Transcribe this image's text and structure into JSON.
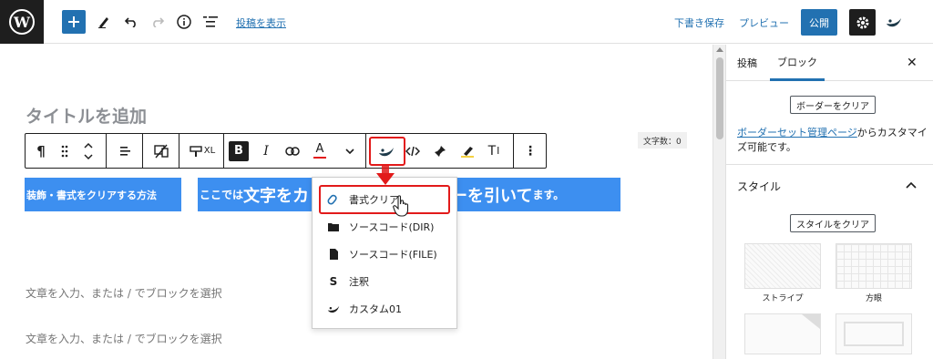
{
  "topbar": {
    "view_post": "投稿を表示",
    "save_draft": "下書き保存",
    "preview": "プレビュー",
    "publish": "公開"
  },
  "editor": {
    "title_placeholder": "タイトルを追加",
    "char_count": "文字数：0",
    "toolbar": {
      "paragraph": "¶",
      "text_xl": "XL",
      "bold": "B",
      "italic": "I",
      "text_color": "A",
      "clear_format": "T",
      "more": "⋮"
    },
    "highlight_1": "装飾・書式をクリアする方法",
    "highlight_2_pre": "ここでは",
    "highlight_2_big": "文字をカ",
    "highlight_2_mid": "ーカーを引いて",
    "highlight_2_suffix": "ます。",
    "placeholder_1": "文章を入力、または / でブロックを選択",
    "placeholder_2": "文章を入力、または / でブロックを選択"
  },
  "dropdown": {
    "items": [
      {
        "label": "書式クリア",
        "icon": "eraser-icon"
      },
      {
        "label": "ソースコード(DIR)",
        "icon": "folder-icon"
      },
      {
        "label": "ソースコード(FILE)",
        "icon": "file-icon"
      },
      {
        "label": "注釈",
        "icon": "s-icon",
        "glyph": "S"
      },
      {
        "label": "カスタム01",
        "icon": "custom-icon"
      }
    ]
  },
  "sidebar": {
    "tabs": [
      "投稿",
      "ブロック"
    ],
    "active_tab": "ブロック",
    "clear_border": "ボーダーをクリア",
    "desc_link": "ボーダーセット管理ページ",
    "desc_rest": "からカスタマイズ可能です。",
    "section_title": "スタイル",
    "clear_style": "スタイルをクリア",
    "styles": [
      "ストライプ",
      "方眼"
    ]
  },
  "colors": {
    "accent": "#2271b1",
    "highlight": "#3d8ff0",
    "annotation": "#e21a1a"
  }
}
